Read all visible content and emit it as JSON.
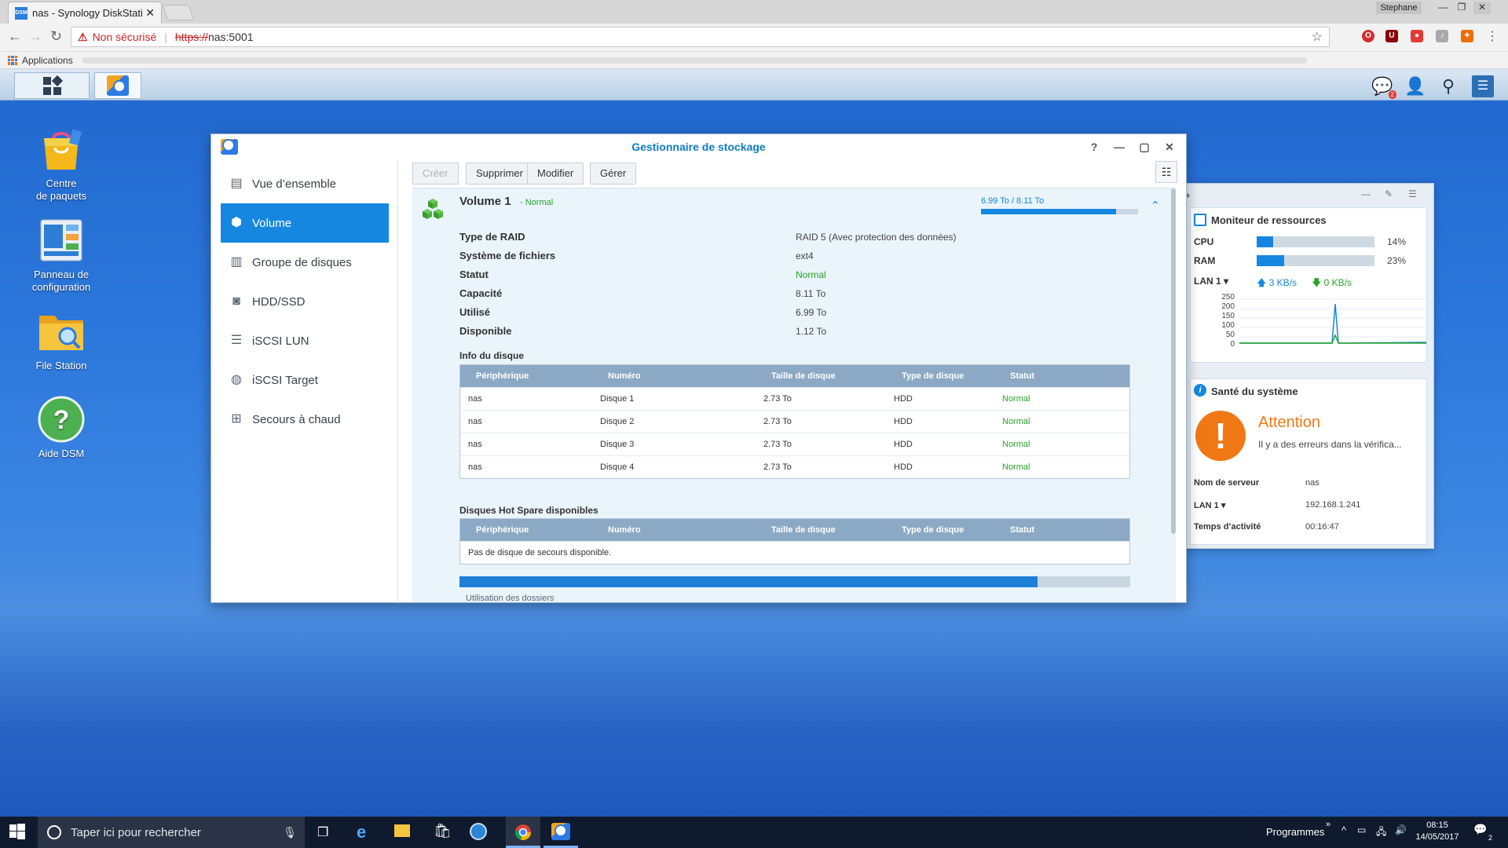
{
  "browser": {
    "tab_title": "nas - Synology DiskStatio",
    "tab_favicon": "DSM",
    "tab_close": "✕",
    "user_label": "Stephane",
    "security_warning": "Non sécurisé",
    "url_protocol": "https://",
    "url_host": "nas:5001",
    "bookmarks_label": "Applications",
    "accent": "#c62828"
  },
  "dsm_taskbar": {
    "notification_count": "2"
  },
  "desktop": {
    "icons": [
      {
        "label1": "Centre",
        "label2": "de paquets"
      },
      {
        "label1": "Panneau de",
        "label2": "configuration"
      },
      {
        "label1": "File Station",
        "label2": ""
      },
      {
        "label1": "Aide DSM",
        "label2": ""
      }
    ]
  },
  "storage_manager": {
    "title": "Gestionnaire de stockage",
    "sidebar": [
      {
        "label": "Vue d’ensemble",
        "icon": "overview-icon"
      },
      {
        "label": "Volume",
        "icon": "volume-icon"
      },
      {
        "label": "Groupe de disques",
        "icon": "disk-group-icon"
      },
      {
        "label": "HDD/SSD",
        "icon": "hdd-icon"
      },
      {
        "label": "iSCSI LUN",
        "icon": "iscsi-lun-icon"
      },
      {
        "label": "iSCSI Target",
        "icon": "iscsi-target-icon"
      },
      {
        "label": "Secours à chaud",
        "icon": "hot-spare-icon"
      }
    ],
    "toolbar": {
      "create": "Créer",
      "delete": "Supprimer",
      "modify": "Modifier",
      "manage": "Gérer"
    },
    "volume": {
      "name": "Volume 1",
      "status_inline": "- Normal",
      "usage_text": "6.99 To / 8.11 To",
      "usage_fraction": 0.862,
      "properties": [
        {
          "label": "Type de RAID",
          "value": "RAID 5 (Avec protection des données)"
        },
        {
          "label": "Système de fichiers",
          "value": "ext4"
        },
        {
          "label": "Statut",
          "value": "Normal"
        },
        {
          "label": "Capacité",
          "value": "8.11 To"
        },
        {
          "label": "Utilisé",
          "value": "6.99 To"
        },
        {
          "label": "Disponible",
          "value": "1.12 To"
        }
      ]
    },
    "disk_info": {
      "title": "Info du disque",
      "columns": [
        "Périphérique",
        "Numéro",
        "Taille de disque",
        "Type de disque",
        "Statut"
      ],
      "rows": [
        [
          "nas",
          "Disque 1",
          "2.73 To",
          "HDD",
          "Normal"
        ],
        [
          "nas",
          "Disque 2",
          "2.73 To",
          "HDD",
          "Normal"
        ],
        [
          "nas",
          "Disque 3",
          "2.73 To",
          "HDD",
          "Normal"
        ],
        [
          "nas",
          "Disque 4",
          "2.73 To",
          "HDD",
          "Normal"
        ]
      ]
    },
    "hot_spare": {
      "title": "Disques Hot Spare disponibles",
      "columns": [
        "Périphérique",
        "Numéro",
        "Taille de disque",
        "Type de disque",
        "Statut"
      ],
      "empty_message": "Pas de disque de secours disponible."
    },
    "usage_fraction": 0.862,
    "cut_label": "Utilisation des dossiers",
    "status_color": "#29a328"
  },
  "resource_monitor": {
    "title": "Moniteur de ressources",
    "cpu_label": "CPU",
    "cpu_pct": "14%",
    "cpu_fraction": 0.14,
    "ram_label": "RAM",
    "ram_pct": "23%",
    "ram_fraction": 0.23,
    "lan_label": "LAN 1",
    "upload": "3 KB/s",
    "download": "0 KB/s",
    "y_ticks": [
      "250",
      "200",
      "150",
      "100",
      "50",
      "0"
    ]
  },
  "system_health": {
    "title": "Santé du système",
    "status": "Attention",
    "message": "Il y a des erreurs dans la vérifica...",
    "rows": [
      {
        "label": "Nom de serveur",
        "value": "nas"
      },
      {
        "label": "LAN 1",
        "value": "192.168.1.241"
      },
      {
        "label": "Temps d’activité",
        "value": "00:16:47"
      }
    ],
    "accent": "#f07814"
  },
  "windows_taskbar": {
    "search_placeholder": "Taper ici pour rechercher",
    "programs_label": "Programmes",
    "time": "08:15",
    "date": "14/05/2017",
    "notifications": "2"
  }
}
